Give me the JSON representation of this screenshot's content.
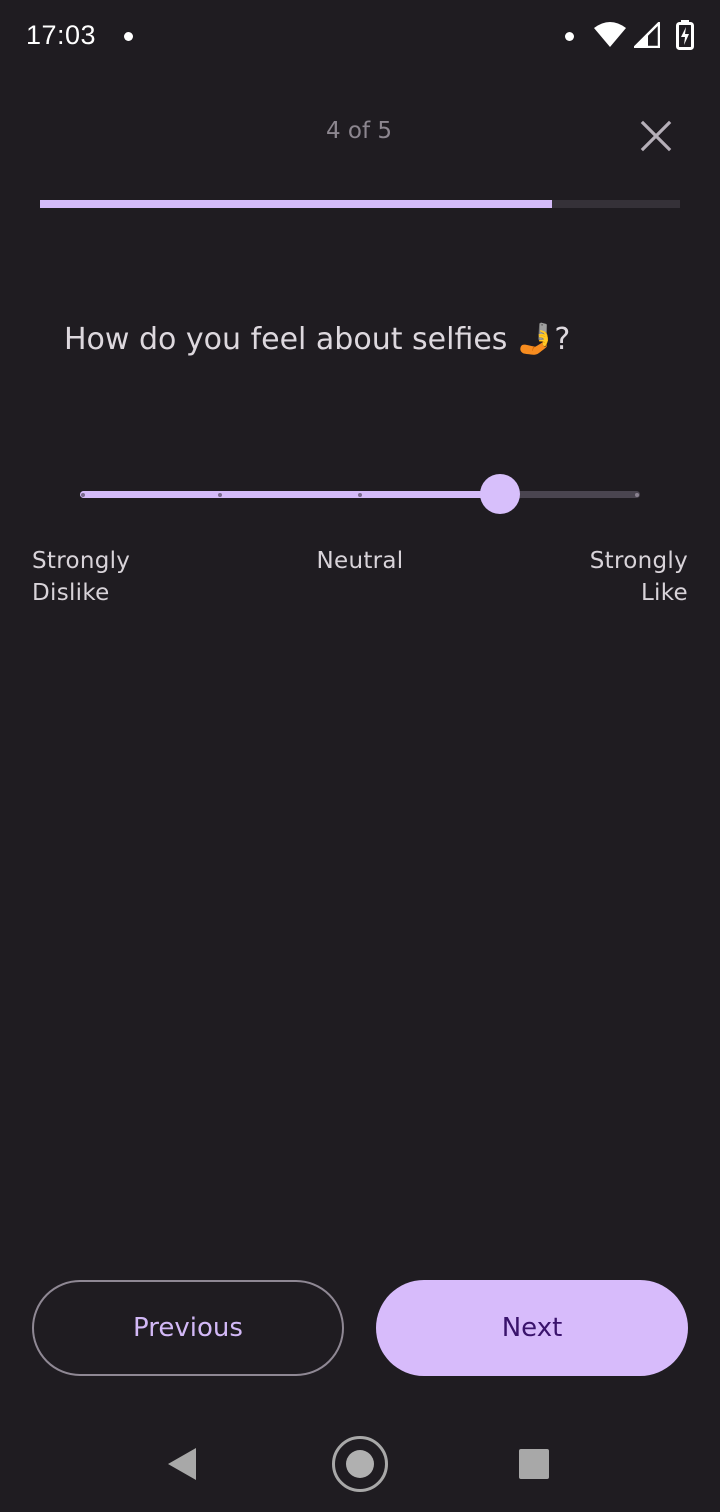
{
  "status_bar": {
    "time": "17:03"
  },
  "header": {
    "step_counter": "4 of 5",
    "progress_fraction": 0.8
  },
  "question": {
    "text": "How do you feel about selfies 🤳?"
  },
  "slider": {
    "steps": 5,
    "value_index": 3,
    "labels": {
      "left": "Strongly\nDislike",
      "middle": "Neutral",
      "right": "Strongly\nLike"
    }
  },
  "buttons": {
    "previous_label": "Previous",
    "next_label": "Next"
  },
  "colors": {
    "background": "#1f1c21",
    "accent": "#d4bbf9",
    "next_text": "#3a136c"
  },
  "icons": {
    "close": "close-icon",
    "wifi": "wifi-icon",
    "signal": "cellular-signal-icon",
    "battery": "battery-charging-icon",
    "back": "nav-back-icon",
    "home": "nav-home-icon",
    "recents": "nav-recents-icon"
  }
}
